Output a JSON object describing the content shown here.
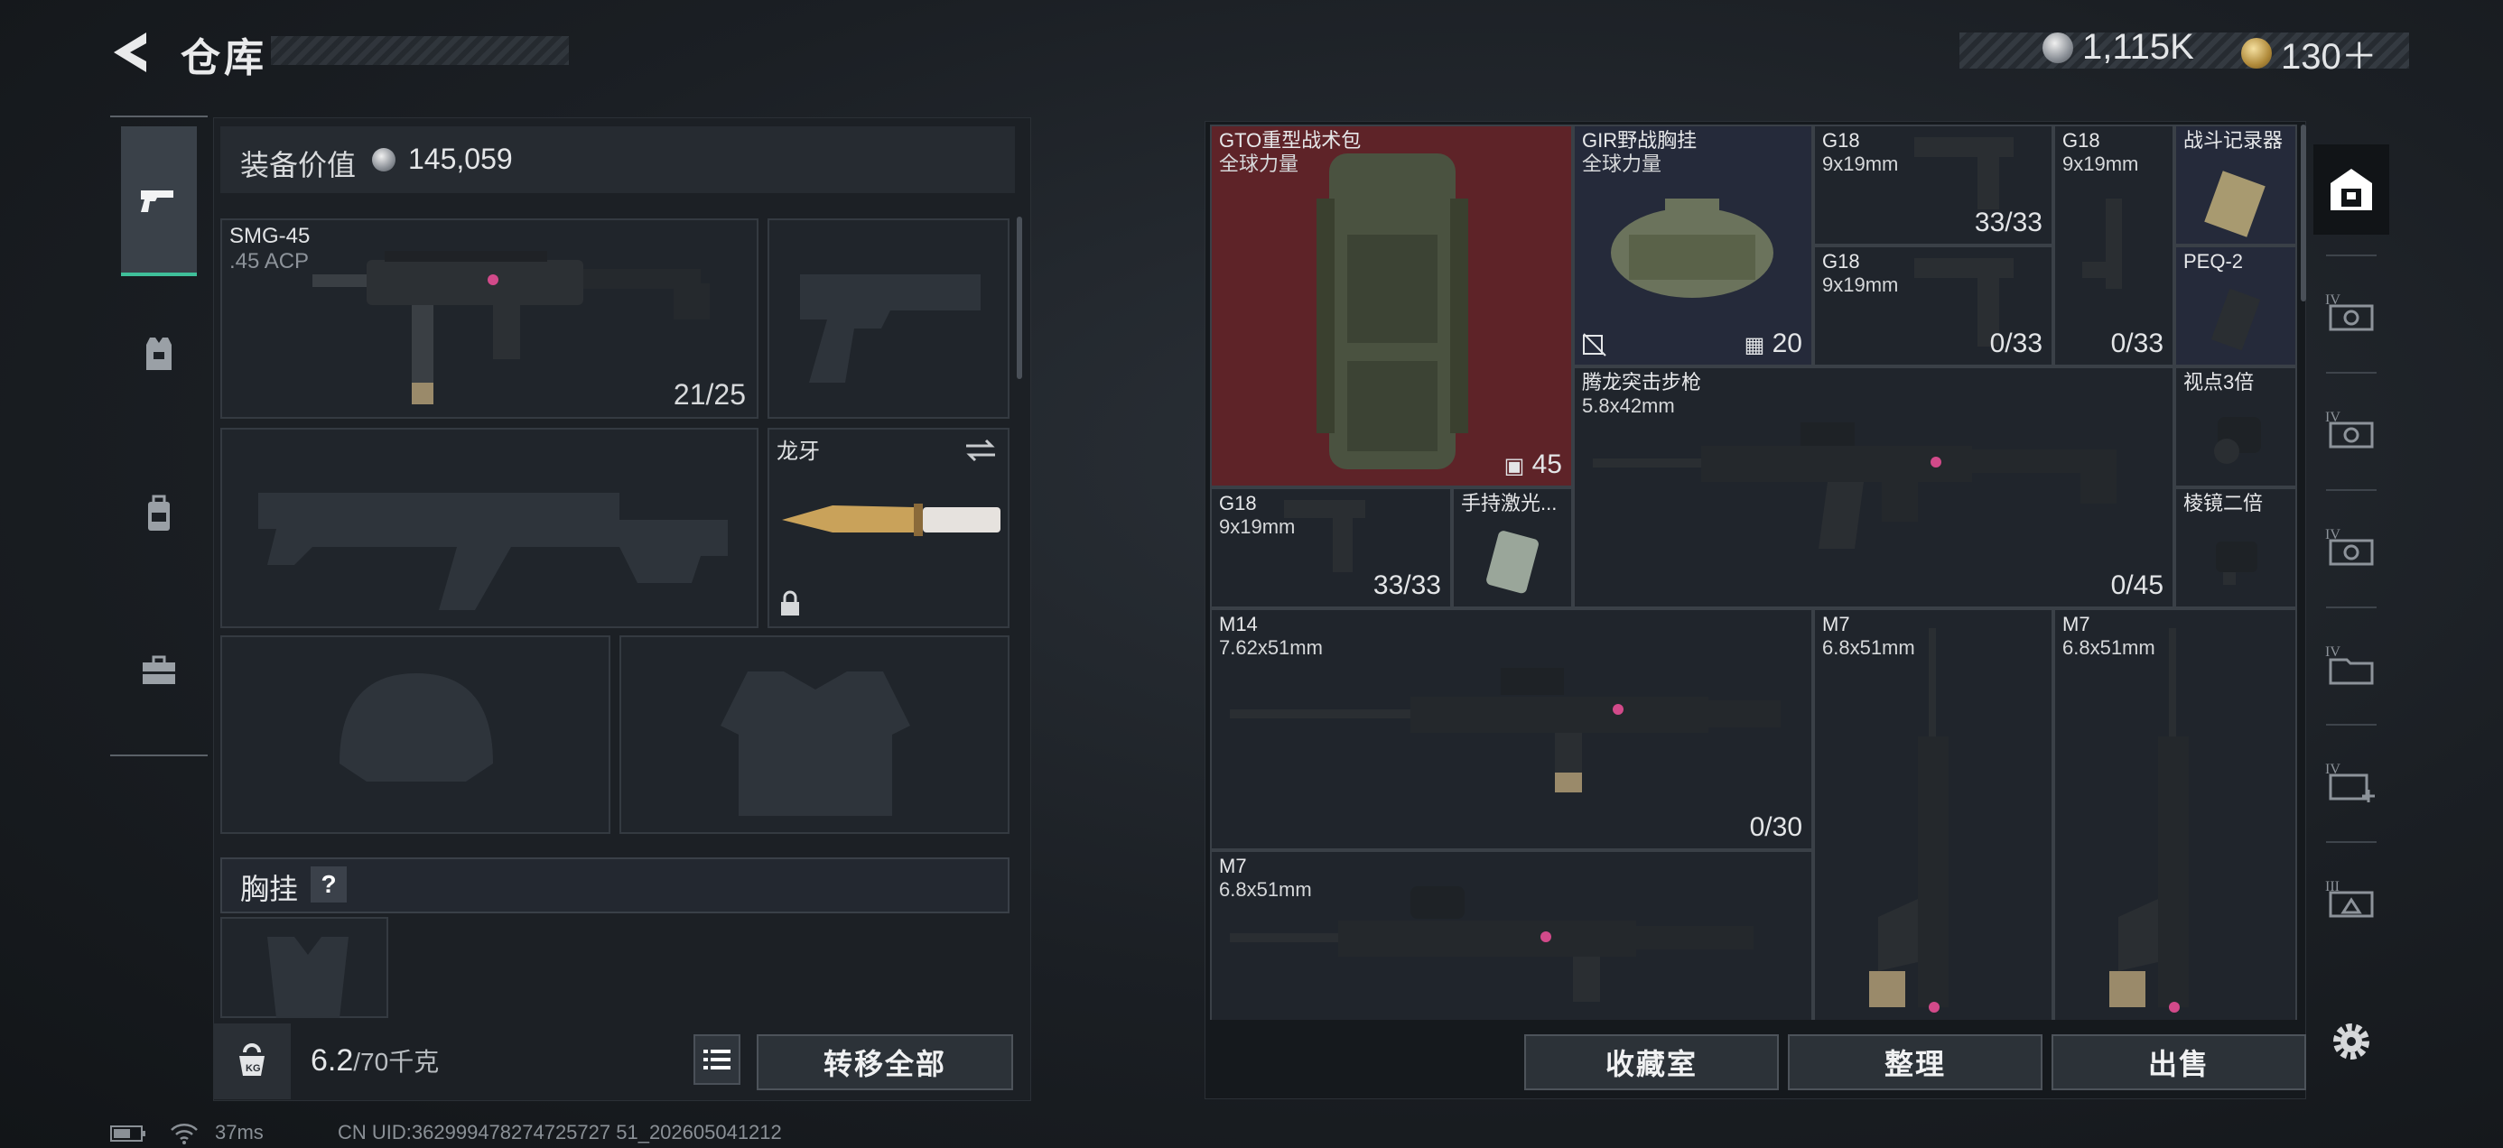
{
  "header": {
    "title": "仓库",
    "currencies": [
      {
        "icon": "silver-coin-icon",
        "value": "1,115K"
      },
      {
        "icon": "gold-coin-icon",
        "value": "130＋"
      }
    ]
  },
  "left_nav": {
    "items": [
      {
        "name": "weapons",
        "icon": "pistol-icon",
        "active": true
      },
      {
        "name": "armor",
        "icon": "armor-vest-icon",
        "active": false
      },
      {
        "name": "backpack",
        "icon": "backpack-icon",
        "active": false
      },
      {
        "name": "toolbox",
        "icon": "toolbox-icon",
        "active": false
      }
    ]
  },
  "loadout": {
    "value_label": "装备价值",
    "value": "145,059",
    "primary": {
      "name": "SMG-45",
      "ammo": ".45 ACP",
      "count": "21/25"
    },
    "melee": {
      "name": "龙牙"
    },
    "chest_rig_label": "胸挂",
    "chest_rig_help": "?"
  },
  "footer_left": {
    "weight_current": "6.2",
    "weight_max": "/70千克",
    "transfer_all": "转移全部"
  },
  "stash": {
    "items": [
      {
        "name": "GTO重型战术包",
        "sub": "全球力量",
        "count": "45"
      },
      {
        "name": "GIR野战胸挂",
        "sub": "全球力量",
        "count": "20"
      },
      {
        "name": "G18",
        "sub": "9x19mm",
        "count": "33/33"
      },
      {
        "name": "G18",
        "sub": "9x19mm",
        "count": "0/33"
      },
      {
        "name": "G18",
        "sub": "9x19mm",
        "count": "0/33"
      },
      {
        "name": "战斗记录器",
        "sub": "",
        "count": ""
      },
      {
        "name": "PEQ-2",
        "sub": "",
        "count": ""
      },
      {
        "name": "腾龙突击步枪",
        "sub": "5.8x42mm",
        "count": "0/45"
      },
      {
        "name": "视点3倍",
        "sub": "",
        "count": ""
      },
      {
        "name": "棱镜二倍",
        "sub": "",
        "count": ""
      },
      {
        "name": "G18",
        "sub": "9x19mm",
        "count": "33/33"
      },
      {
        "name": "手持激光...",
        "sub": "",
        "count": ""
      },
      {
        "name": "M14",
        "sub": "7.62x51mm",
        "count": "0/30"
      },
      {
        "name": "M7",
        "sub": "6.8x51mm",
        "count": ""
      },
      {
        "name": "M7",
        "sub": "6.8x51mm",
        "count": ""
      },
      {
        "name": "M7",
        "sub": "6.8x51mm",
        "count": ""
      }
    ]
  },
  "footer_right": {
    "collection": "收藏室",
    "organize": "整理",
    "sell": "出售"
  },
  "right_sidebar": {
    "items": [
      {
        "icon": "safe-box-icon",
        "active": true
      },
      {
        "icon": "stash-tab-iv-icon",
        "level": "IV"
      },
      {
        "icon": "stash-tab-iv-icon",
        "level": "IV"
      },
      {
        "icon": "stash-tab-iv-icon",
        "level": "IV"
      },
      {
        "icon": "stash-folder-iv-icon",
        "level": "IV"
      },
      {
        "icon": "stash-add-iv-icon",
        "level": "IV"
      },
      {
        "icon": "stash-tab-iii-icon",
        "level": "III"
      }
    ],
    "settings_icon": "gear-icon"
  },
  "status_bar": {
    "ping": "37ms",
    "uid": "CN UID:362999478274725727 51_202605041212"
  },
  "colors": {
    "accent": "#3fbf9a",
    "highlight_cell": "#5e2328",
    "panel_bg": "#1c2025"
  }
}
